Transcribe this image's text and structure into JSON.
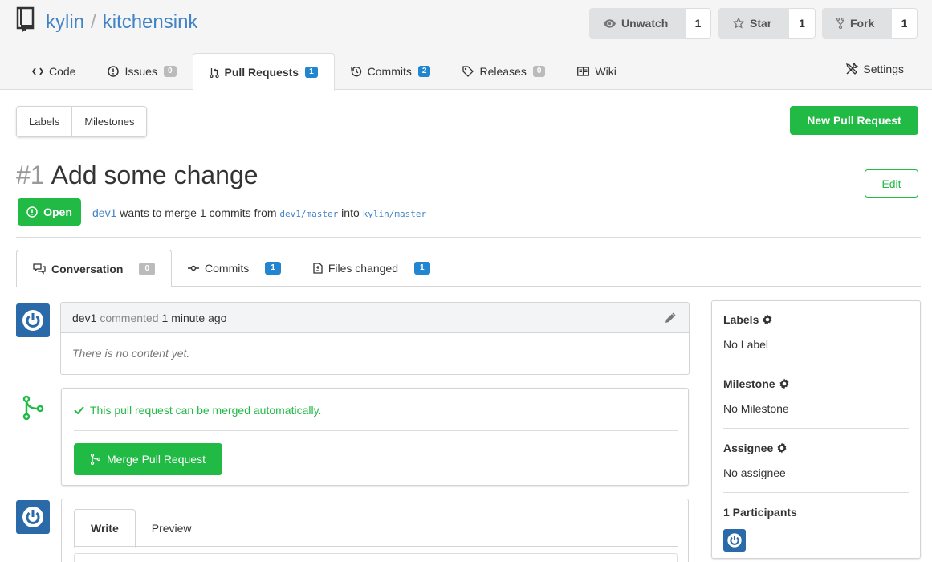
{
  "repo": {
    "owner": "kylin",
    "separator": "/",
    "name": "kitchensink"
  },
  "actions": {
    "watch": {
      "label": "Unwatch",
      "count": "1"
    },
    "star": {
      "label": "Star",
      "count": "1"
    },
    "fork": {
      "label": "Fork",
      "count": "1"
    }
  },
  "nav": {
    "tabs": [
      {
        "label": "Code"
      },
      {
        "label": "Issues",
        "count": "0"
      },
      {
        "label": "Pull Requests",
        "count": "1"
      },
      {
        "label": "Commits",
        "count": "2"
      },
      {
        "label": "Releases",
        "count": "0"
      },
      {
        "label": "Wiki"
      }
    ],
    "settings": "Settings"
  },
  "subbar": {
    "labels": "Labels",
    "milestones": "Milestones",
    "new_pr": "New Pull Request"
  },
  "pr": {
    "number": "#1",
    "title": "Add some change",
    "edit": "Edit",
    "status": "Open",
    "author": "dev1",
    "merge_text_1": "wants to merge 1 commits from",
    "head_branch": "dev1/master",
    "merge_text_2": "into",
    "base_branch": "kylin/master"
  },
  "pr_tabs": [
    {
      "label": "Conversation",
      "count": "0"
    },
    {
      "label": "Commits",
      "count": "1"
    },
    {
      "label": "Files changed",
      "count": "1"
    }
  ],
  "comment": {
    "author": "dev1",
    "action": "commented",
    "time": "1 minute ago",
    "body": "There is no content yet."
  },
  "merge": {
    "status": "This pull request can be merged automatically.",
    "button": "Merge Pull Request"
  },
  "reply": {
    "write": "Write",
    "preview": "Preview"
  },
  "sidebar": {
    "labels": {
      "title": "Labels",
      "value": "No Label"
    },
    "milestone": {
      "title": "Milestone",
      "value": "No Milestone"
    },
    "assignee": {
      "title": "Assignee",
      "value": "No assignee"
    },
    "participants": {
      "title": "1 Participants"
    }
  },
  "colors": {
    "accent_green": "#21ba45",
    "link_blue": "#4183c4",
    "badge_blue": "#2185d0",
    "avatar_blue": "#2b6aa8"
  }
}
